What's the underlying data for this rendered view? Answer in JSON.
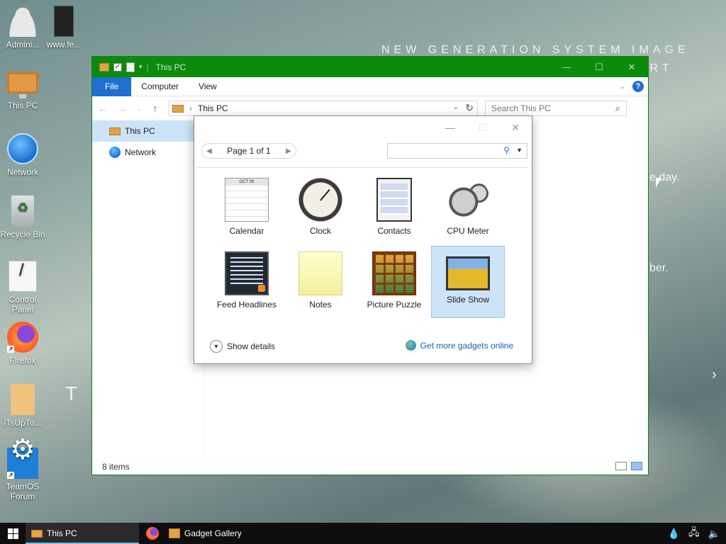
{
  "desktop": {
    "icons": [
      {
        "label": "Admini...",
        "icon": "user-icon"
      },
      {
        "label": "www.fe...",
        "icon": "file-icon"
      },
      {
        "label": "This PC",
        "icon": "computer-icon"
      },
      {
        "label": "Network",
        "icon": "network-icon"
      },
      {
        "label": "Recycle Bin",
        "icon": "recycle-bin-icon"
      },
      {
        "label": "Control Panel",
        "icon": "control-panel-icon"
      },
      {
        "label": "Firefox",
        "icon": "firefox-icon"
      },
      {
        "label": "iTsUpTo...",
        "icon": "folder-icon"
      },
      {
        "label": "TeamOS Forum",
        "icon": "gear-icon"
      }
    ],
    "wallpaper_text_1": "NEW GENERATION SYSTEM IMAGE",
    "wallpaper_text_2": "ORT",
    "wallpaper_text_3": "T C",
    "wallpaper_text_4": "e day.",
    "wallpaper_text_5": "ber."
  },
  "explorer": {
    "title": "This PC",
    "ribbon_tabs": [
      "File",
      "Computer",
      "View"
    ],
    "address": "This PC",
    "search_placeholder": "Search This PC",
    "nav_items": [
      "This PC",
      "Network"
    ],
    "status": "8 items"
  },
  "gadget_gallery": {
    "page_label": "Page 1 of 1",
    "search_value": "",
    "gadgets": [
      {
        "name": "Calendar",
        "icon": "calendar-icon"
      },
      {
        "name": "Clock",
        "icon": "clock-icon"
      },
      {
        "name": "Contacts",
        "icon": "contacts-icon"
      },
      {
        "name": "CPU Meter",
        "icon": "cpu-meter-icon"
      },
      {
        "name": "Feed Headlines",
        "icon": "feed-headlines-icon"
      },
      {
        "name": "Notes",
        "icon": "notes-icon"
      },
      {
        "name": "Picture Puzzle",
        "icon": "picture-puzzle-icon"
      },
      {
        "name": "Slide Show",
        "icon": "slide-show-icon",
        "selected": true
      }
    ],
    "show_details_label": "Show details",
    "get_more_label": "Get more gadgets online"
  },
  "taskbar": {
    "items": [
      {
        "label": "This PC",
        "active": true
      },
      {
        "label": "Gadget Gallery",
        "active": false
      }
    ]
  },
  "colors": {
    "titlebar": "#0b8a0b",
    "file_tab": "#1e6fd1",
    "selection": "#cde3f7",
    "taskbar": "#0e0e0e"
  }
}
